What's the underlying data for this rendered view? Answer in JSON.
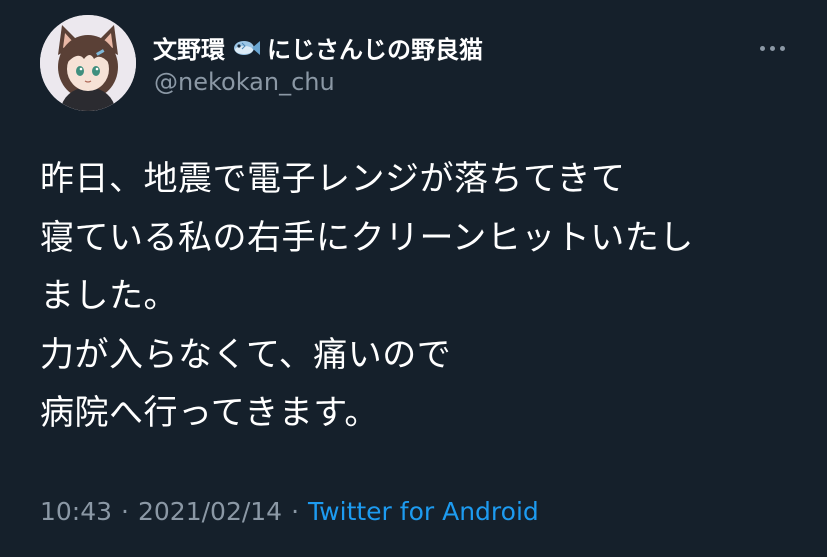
{
  "author": {
    "display_name": "文野環",
    "emoji": "fish-emoji",
    "display_name_suffix": "にじさんじの野良猫",
    "handle": "@nekokan_chu"
  },
  "tweet": {
    "lines": [
      "昨日、地震で電子レンジが落ちてきて",
      "寝ている私の右手にクリーンヒットいたし",
      "ました。",
      "力が入らなくて、痛いので",
      "病院へ行ってきます。"
    ]
  },
  "meta": {
    "time": "10:43",
    "separator": "·",
    "date": "2021/02/14",
    "source": "Twitter for Android"
  },
  "colors": {
    "background": "#15202b",
    "text": "#ffffff",
    "secondary": "#8b98a5",
    "accent": "#1d9bf0"
  },
  "icons": {
    "more": "more-horizontal-icon"
  }
}
